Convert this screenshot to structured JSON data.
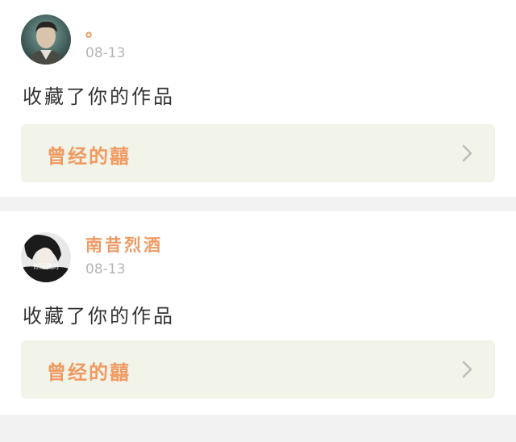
{
  "feed": {
    "items": [
      {
        "username": "。",
        "date": "08-13",
        "action": "收藏了你的作品",
        "work_title": "曾经的囍",
        "avatar_icon": "avatar-photo-man"
      },
      {
        "username": "南昔烈酒",
        "date": "08-13",
        "action": "收藏了你的作品",
        "work_title": "曾经的囍",
        "avatar_icon": "avatar-photo-bw",
        "avatar_caption": "你是我的"
      }
    ]
  },
  "colors": {
    "accent": "#f09a63",
    "date_gray": "#b5b5b5",
    "work_box_bg": "#f2f4ea",
    "page_bg": "#f2f2f2"
  }
}
